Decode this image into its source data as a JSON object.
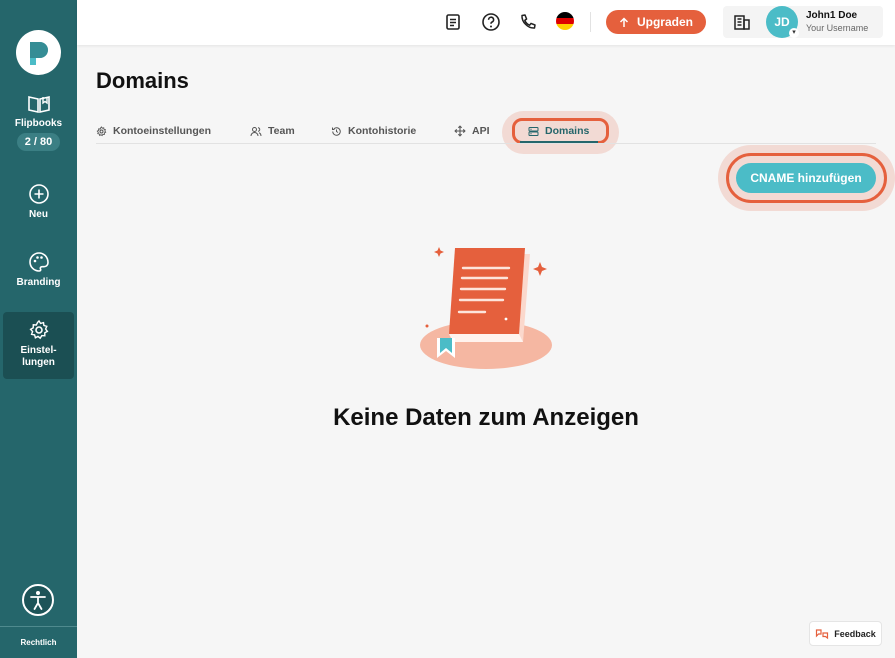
{
  "sidebar": {
    "flipbooks_label": "Flipbooks",
    "flipbooks_count": "2 / 80",
    "new_label": "Neu",
    "branding_label": "Branding",
    "settings_label_line1": "Einstel-",
    "settings_label_line2": "lungen",
    "legal_label": "Rechtlich"
  },
  "topbar": {
    "upgrade_label": "Upgraden",
    "avatar_initials": "JD",
    "user_name": "John1 Doe",
    "user_subtitle": "Your Username"
  },
  "page": {
    "title": "Domains",
    "tabs": [
      {
        "label": "Kontoeinstellungen"
      },
      {
        "label": "Team"
      },
      {
        "label": "Kontohistorie"
      },
      {
        "label": "API"
      },
      {
        "label": "Domains"
      }
    ],
    "add_cname_label": "CNAME hinzufügen",
    "empty_state": "Keine Daten zum Anzeigen"
  },
  "feedback_label": "Feedback",
  "colors": {
    "sidebar": "#25666b",
    "accent_orange": "#e5603d",
    "accent_teal": "#4bbcc7"
  }
}
